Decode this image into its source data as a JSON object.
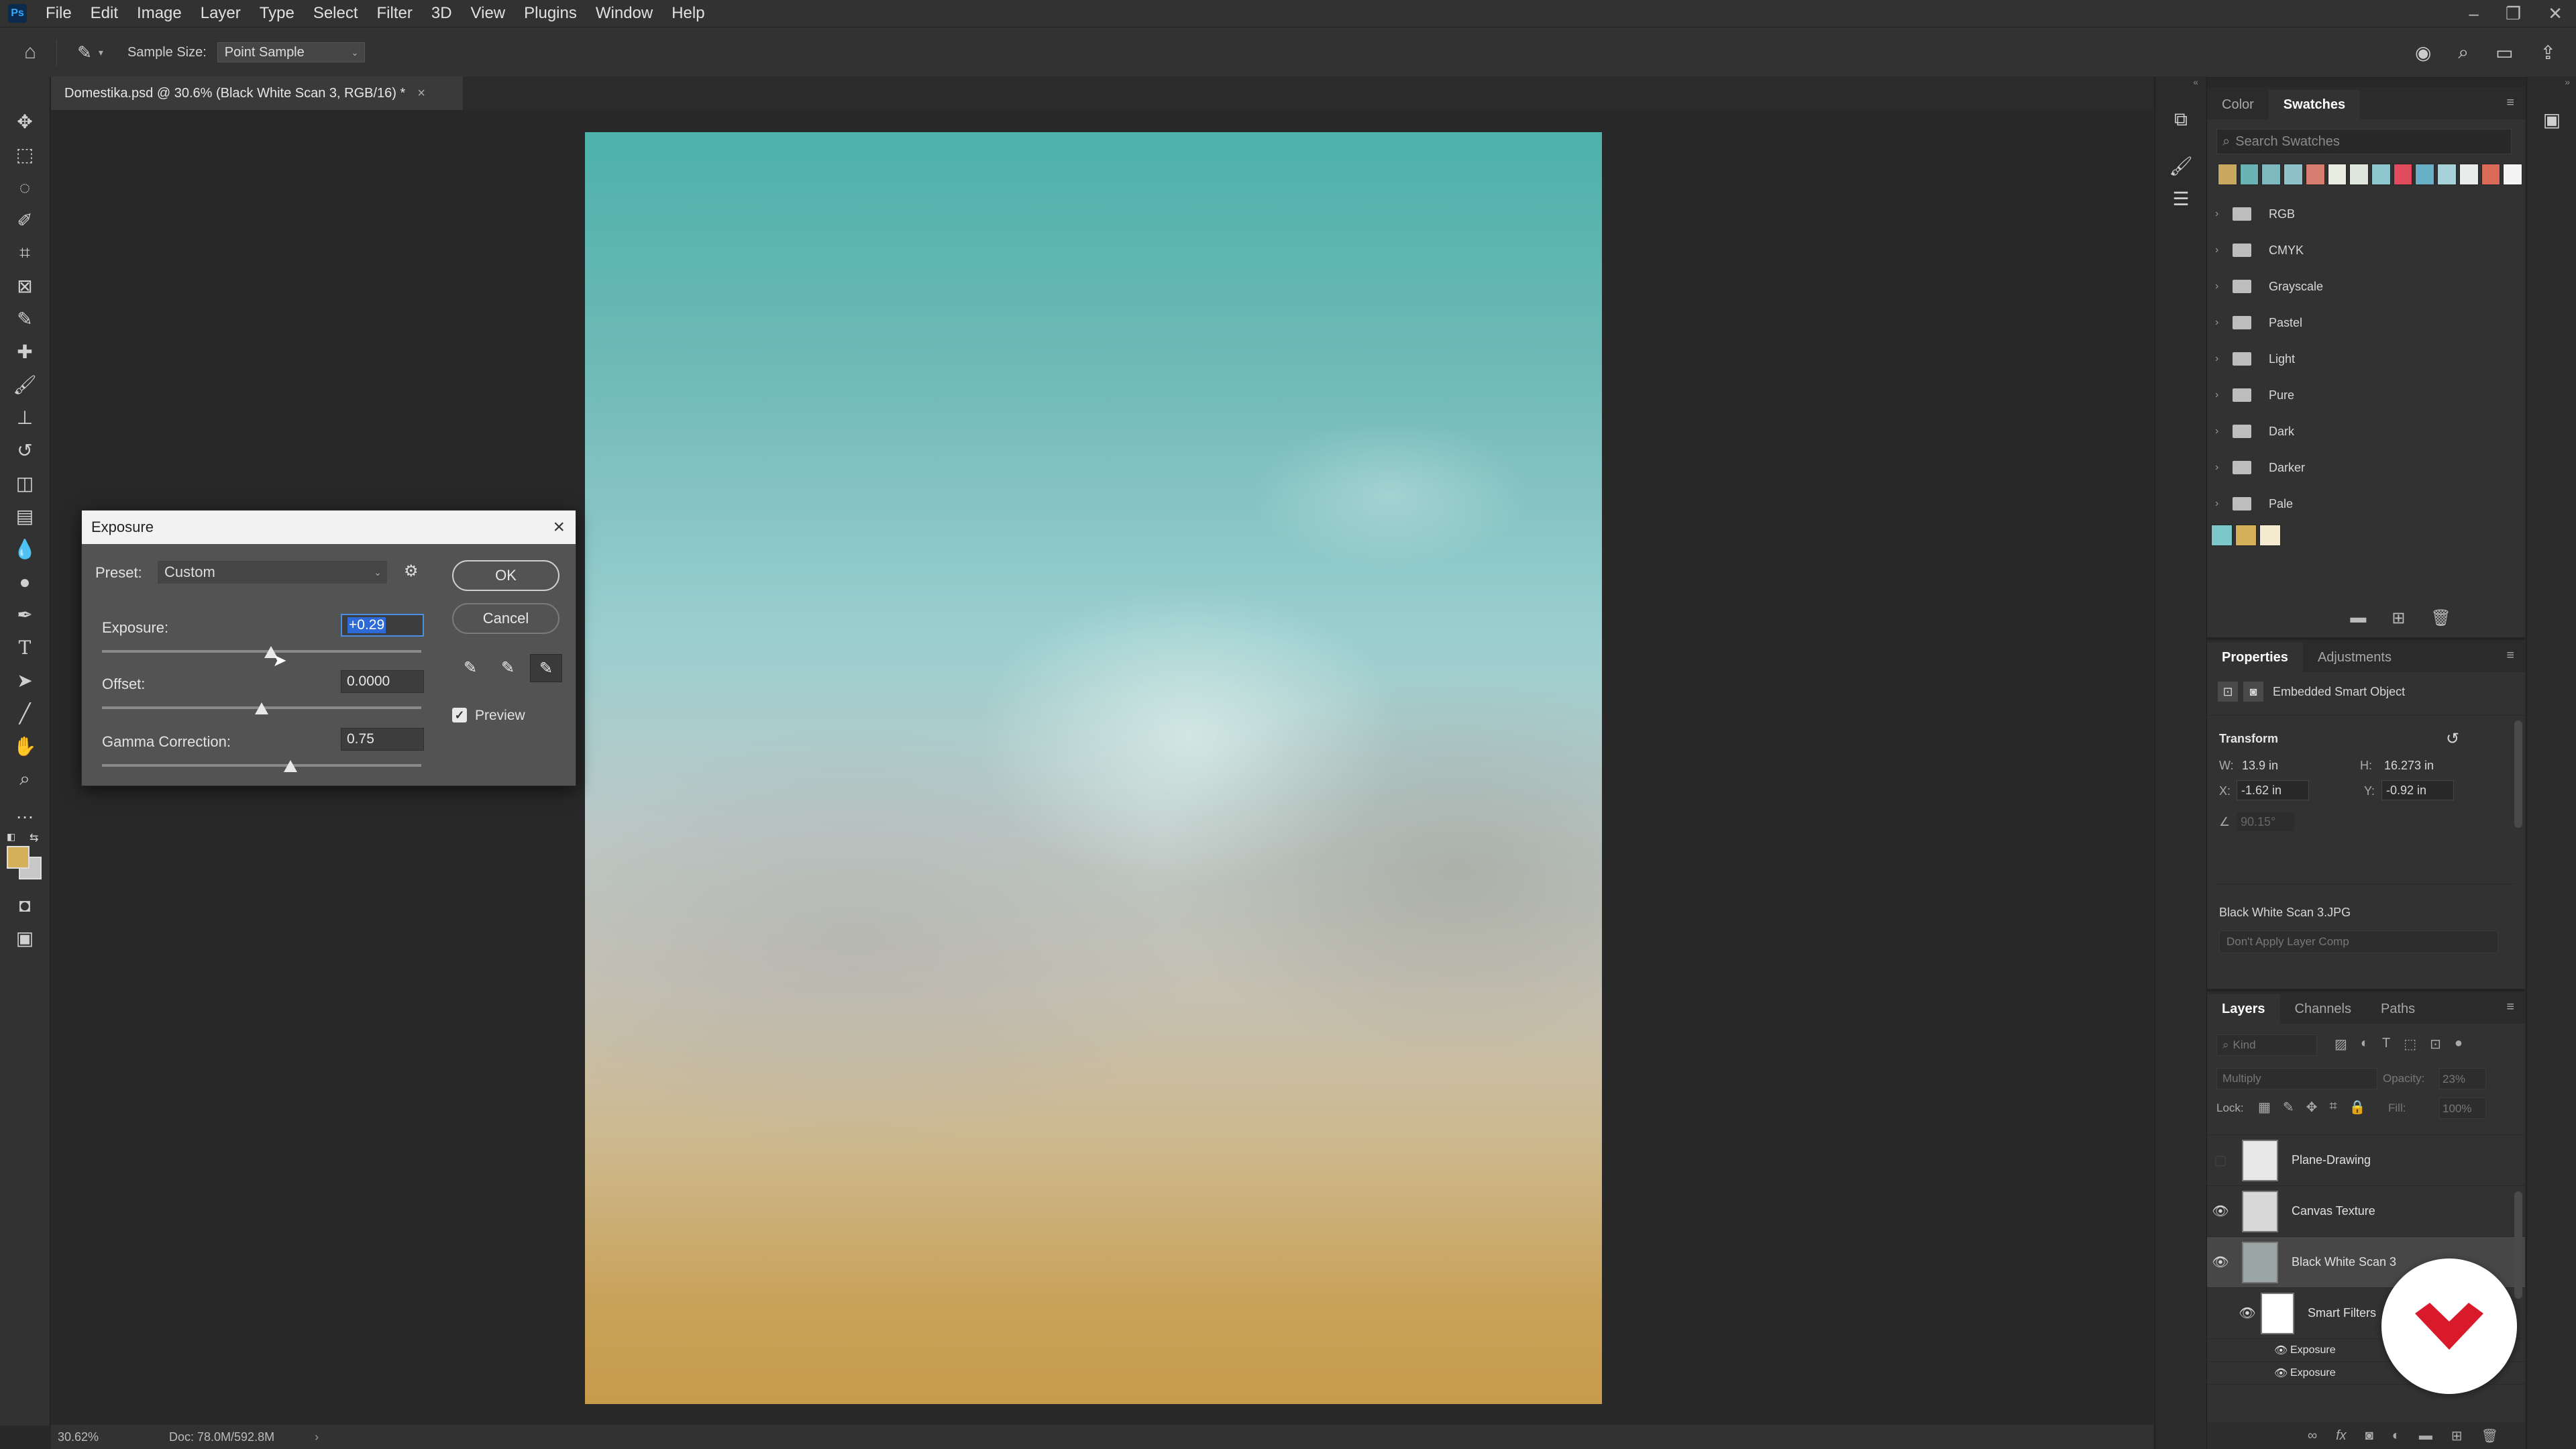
{
  "app": {
    "logo_text": "Ps"
  },
  "menubar": {
    "items": [
      "File",
      "Edit",
      "Image",
      "Layer",
      "Type",
      "Select",
      "Filter",
      "3D",
      "View",
      "Plugins",
      "Window",
      "Help"
    ]
  },
  "window_controls": {
    "minimize": "–",
    "restore": "❐",
    "close": "✕"
  },
  "options_bar": {
    "sample_size_label": "Sample Size:",
    "sample_size_value": "Point Sample"
  },
  "document": {
    "tab_title": "Domestika.psd @ 30.6% (Black White Scan 3, RGB/16) *",
    "zoom": "30.62%",
    "doc_size": "Doc: 78.0M/592.8M"
  },
  "swatches_panel": {
    "tabs": [
      "Color",
      "Swatches"
    ],
    "active_tab": "Swatches",
    "search_placeholder": "Search Swatches",
    "recent_colors": [
      "#c8a85e",
      "#6ab3b5",
      "#7fb8bd",
      "#8fc2c8",
      "#d67d72",
      "#e8ece0",
      "#dfe6dc",
      "#8fc7cf",
      "#e04c5e",
      "#68b0c6",
      "#a7d2da",
      "#e8ecea",
      "#d96a5a",
      "#f4f4f4"
    ],
    "groups": [
      "RGB",
      "CMYK",
      "Grayscale",
      "Pastel",
      "Light",
      "Pure",
      "Dark",
      "Darker",
      "Pale"
    ],
    "loose_swatches": [
      "#7cc7c9",
      "#d5b05a",
      "#f3ead0"
    ]
  },
  "properties_panel": {
    "tabs": [
      "Properties",
      "Adjustments"
    ],
    "active_tab": "Properties",
    "object_type": "Embedded Smart Object",
    "transform_label": "Transform",
    "w_label": "W:",
    "w_value": "13.9 in",
    "h_label": "H:",
    "h_value": "16.273 in",
    "x_label": "X:",
    "x_value": "-1.62 in",
    "y_label": "Y:",
    "y_value": "-0.92 in",
    "angle_value": "90.15°",
    "source_file": "Black White Scan 3.JPG",
    "layer_comp": "Don't Apply Layer Comp"
  },
  "layers_panel": {
    "tabs": [
      "Layers",
      "Channels",
      "Paths"
    ],
    "active_tab": "Layers",
    "filter_kind": "Kind",
    "blend_mode": "Multiply",
    "opacity_label": "Opacity:",
    "opacity_value": "23%",
    "lock_label": "Lock:",
    "fill_label": "Fill:",
    "fill_value": "100%",
    "layers": [
      {
        "name": "Plane-Drawing",
        "visible": false
      },
      {
        "name": "Canvas Texture",
        "visible": true
      },
      {
        "name": "Black White Scan 3",
        "visible": true,
        "selected": true
      }
    ],
    "smart_filter_label": "Smart Filters",
    "filters": [
      "Exposure",
      "Exposure"
    ]
  },
  "exposure_dialog": {
    "title": "Exposure",
    "preset_label": "Preset:",
    "preset_value": "Custom",
    "exposure_label": "Exposure:",
    "exposure_value": "+0.29",
    "exposure_slider_fraction": 0.53,
    "offset_label": "Offset:",
    "offset_value": "0.0000",
    "offset_slider_fraction": 0.5,
    "gamma_label": "Gamma Correction:",
    "gamma_value": "0.75",
    "gamma_slider_fraction": 0.59,
    "ok_label": "OK",
    "cancel_label": "Cancel",
    "preview_label": "Preview",
    "preview_checked": true
  }
}
